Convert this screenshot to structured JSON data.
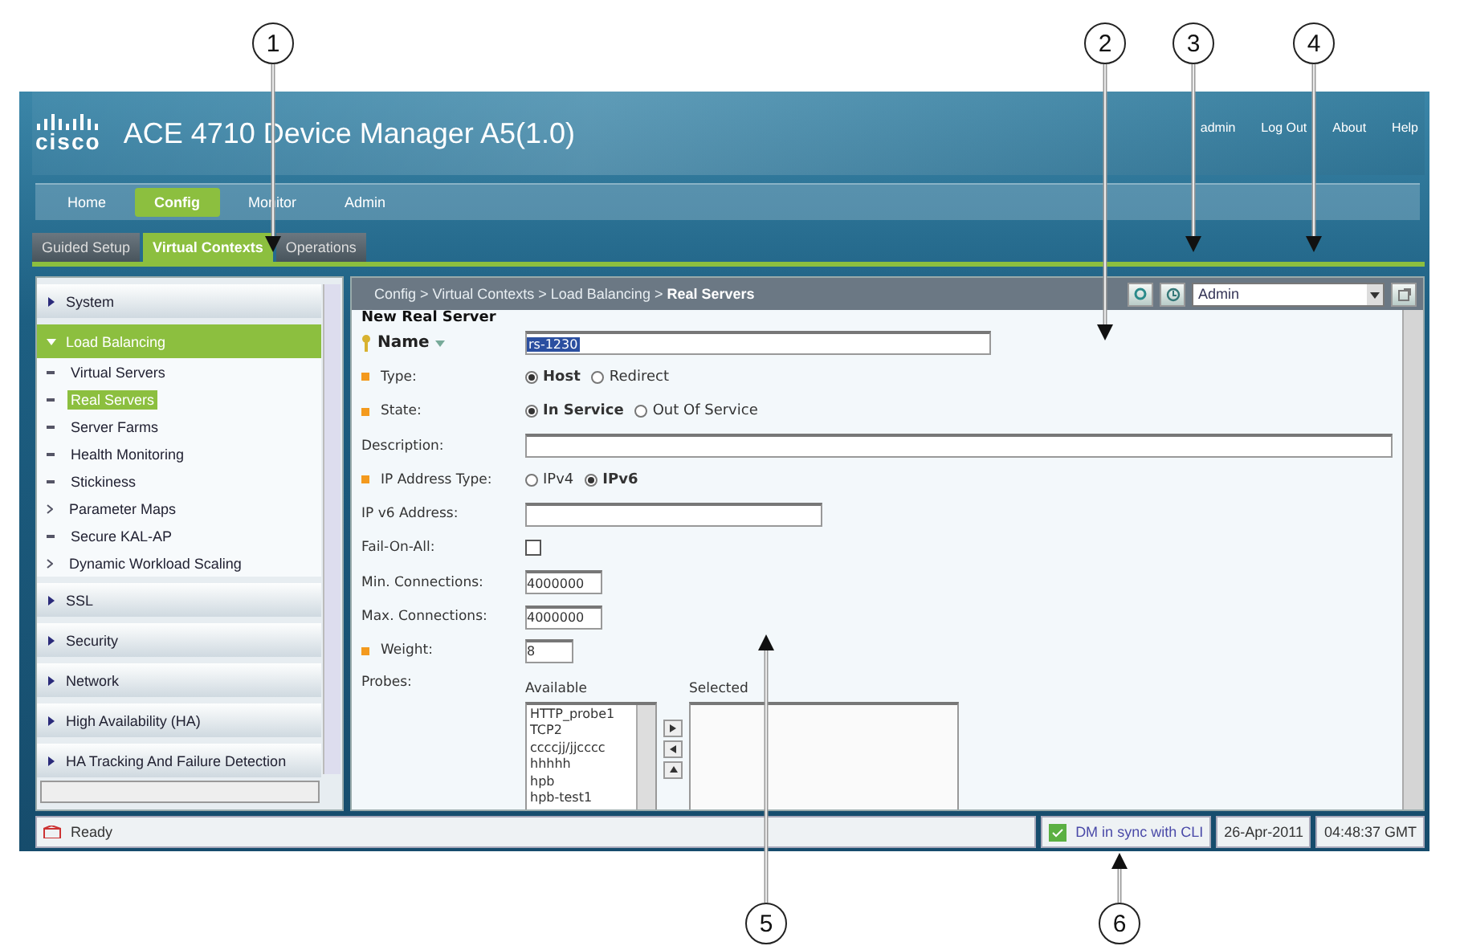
{
  "callouts": [
    {
      "label": "1"
    },
    {
      "label": "2"
    },
    {
      "label": "3"
    },
    {
      "label": "4"
    },
    {
      "label": "5"
    },
    {
      "label": "6"
    }
  ],
  "header": {
    "logo": "cisco",
    "title": "ACE 4710 Device Manager A5(1.0)",
    "links": [
      "admin",
      "Log Out",
      "About",
      "Help"
    ]
  },
  "nav_tabs": [
    {
      "label": "Home",
      "selected": false
    },
    {
      "label": "Config",
      "selected": true
    },
    {
      "label": "Monitor",
      "selected": false
    },
    {
      "label": "Admin",
      "selected": false
    }
  ],
  "sub_tabs": [
    {
      "label": "Guided Setup",
      "selected": false
    },
    {
      "label": "Virtual Contexts",
      "selected": true
    },
    {
      "label": "Operations",
      "selected": false
    }
  ],
  "sidebar": {
    "sections": [
      {
        "label": "System",
        "expanded": false
      },
      {
        "label": "Load Balancing",
        "expanded": true,
        "children": [
          {
            "label": "Virtual Servers",
            "kind": "leaf",
            "selected": false
          },
          {
            "label": "Real Servers",
            "kind": "leaf",
            "selected": true
          },
          {
            "label": "Server Farms",
            "kind": "leaf",
            "selected": false
          },
          {
            "label": "Health Monitoring",
            "kind": "leaf",
            "selected": false
          },
          {
            "label": "Stickiness",
            "kind": "leaf",
            "selected": false
          },
          {
            "label": "Parameter Maps",
            "kind": "folder",
            "selected": false
          },
          {
            "label": "Secure KAL-AP",
            "kind": "leaf",
            "selected": false
          },
          {
            "label": "Dynamic Workload Scaling",
            "kind": "folder",
            "selected": false
          }
        ]
      },
      {
        "label": "SSL",
        "expanded": false
      },
      {
        "label": "Security",
        "expanded": false
      },
      {
        "label": "Network",
        "expanded": false
      },
      {
        "label": "High Availability (HA)",
        "expanded": false
      },
      {
        "label": "HA Tracking And Failure Detection",
        "expanded": false
      }
    ]
  },
  "toolbar": {
    "breadcrumb": "Config > Virtual Contexts > Load Balancing > **Real Servers**",
    "role": "Admin"
  },
  "form": {
    "title": "New Real Server",
    "rows": [
      {
        "kind": "name",
        "label": "Name",
        "value": "rs-1230",
        "required": false
      },
      {
        "kind": "radio",
        "label": "Type:",
        "required": true,
        "options": [
          {
            "label": "Host",
            "selected": true
          },
          {
            "label": "Redirect",
            "selected": false
          }
        ]
      },
      {
        "kind": "radio",
        "label": "State:",
        "required": true,
        "options": [
          {
            "label": "In Service",
            "selected": true
          },
          {
            "label": "Out Of Service",
            "selected": false
          }
        ]
      },
      {
        "kind": "long_text",
        "label": "Description:",
        "required": false
      },
      {
        "kind": "radio",
        "label": "IP Address Type:",
        "required": true,
        "options": [
          {
            "label": "IPv4",
            "selected": false
          },
          {
            "label": "IPv6",
            "selected": true
          }
        ]
      },
      {
        "kind": "text",
        "label": "IP v6 Address:",
        "required": false
      },
      {
        "kind": "checkbox",
        "label": "Fail-On-All:",
        "required": false,
        "checked": false
      },
      {
        "kind": "number",
        "label": "Min. Connections:",
        "required": false,
        "value": "4000000"
      },
      {
        "kind": "number",
        "label": "Max. Connections:",
        "required": false,
        "value": "4000000"
      },
      {
        "kind": "short_number",
        "label": "Weight:",
        "required": true,
        "value": "8"
      },
      {
        "kind": "probes",
        "label": "Probes:",
        "required": false,
        "available_label": "Available",
        "selected_label": "Selected",
        "available": [
          "HTTP_probe1",
          "TCP2",
          "ccccjj/jjcccc",
          "hhhhh",
          "hpb",
          "hpb-test1"
        ]
      }
    ]
  },
  "status_bar": {
    "status": "Ready",
    "sync": "DM in sync with CLI",
    "date": "26-Apr-2011",
    "time": "04:48:37 GMT"
  }
}
